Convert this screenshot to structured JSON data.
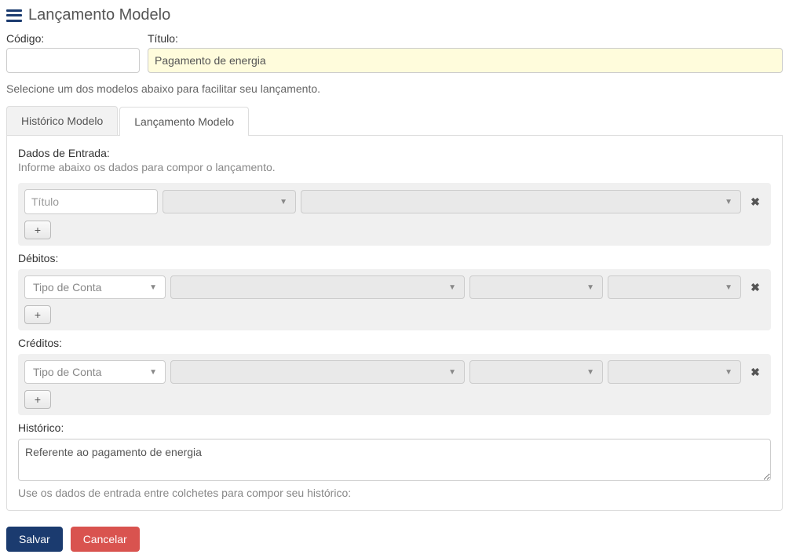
{
  "header": {
    "title": "Lançamento Modelo"
  },
  "fields": {
    "codigo_label": "Código:",
    "codigo_value": "",
    "titulo_label": "Título:",
    "titulo_value": "Pagamento de energia"
  },
  "hint": "Selecione um dos modelos abaixo para facilitar seu lançamento.",
  "tabs": {
    "historico": "Histórico Modelo",
    "lancamento": "Lançamento Modelo"
  },
  "dados": {
    "title": "Dados de Entrada:",
    "sub": "Informe abaixo os dados para compor o lançamento.",
    "titulo_placeholder": "Título",
    "add": "+"
  },
  "debitos": {
    "label": "Débitos:",
    "tipo_placeholder": "Tipo de Conta",
    "add": "+"
  },
  "creditos": {
    "label": "Créditos:",
    "tipo_placeholder": "Tipo de Conta",
    "add": "+"
  },
  "historico": {
    "label": "Histórico:",
    "value": "Referente ao pagamento de energia",
    "note": "Use os dados de entrada entre colchetes para compor seu histórico:"
  },
  "actions": {
    "save": "Salvar",
    "cancel": "Cancelar"
  }
}
